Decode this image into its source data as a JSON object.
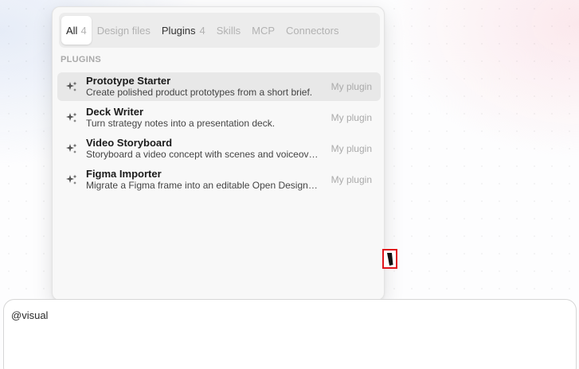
{
  "filter_tabs": [
    {
      "label": "All",
      "count": "4"
    },
    {
      "label": "Design files",
      "count": ""
    },
    {
      "label": "Plugins",
      "count": "4"
    },
    {
      "label": "Skills",
      "count": ""
    },
    {
      "label": "MCP",
      "count": ""
    },
    {
      "label": "Connectors",
      "count": ""
    }
  ],
  "section_label": "PLUGINS",
  "items": [
    {
      "title": "Prototype Starter",
      "description": "Create polished product prototypes from a short brief.",
      "tag": "My plugin",
      "icon": "sparkle-icon"
    },
    {
      "title": "Deck Writer",
      "description": "Turn strategy notes into a presentation deck.",
      "tag": "My plugin",
      "icon": "sparkle-icon"
    },
    {
      "title": "Video Storyboard",
      "description": "Storyboard a video concept with scenes and voiceover.",
      "tag": "My plugin",
      "icon": "sparkle-icon"
    },
    {
      "title": "Figma Importer",
      "description": "Migrate a Figma frame into an editable Open Design project.",
      "tag": "My plugin",
      "icon": "sparkle-icon"
    }
  ],
  "composer": {
    "value": "@visual"
  },
  "colors": {
    "highlight": "#e0141b",
    "selected_row": "#e8e8e8"
  }
}
